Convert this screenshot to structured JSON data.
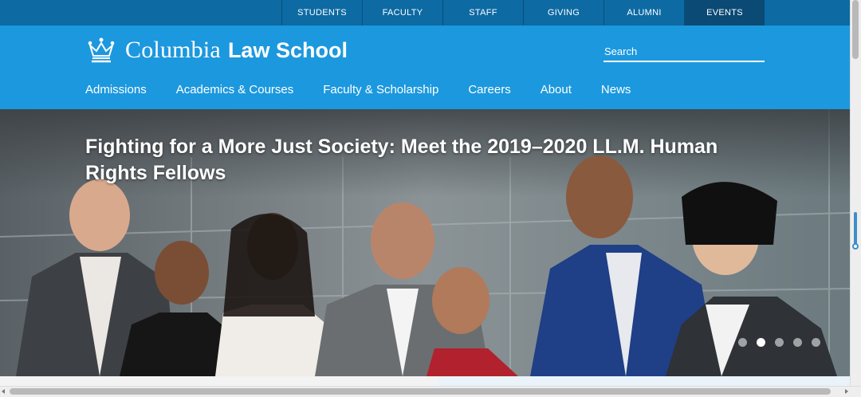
{
  "utility_nav": {
    "items": [
      {
        "label": "STUDENTS"
      },
      {
        "label": "FACULTY"
      },
      {
        "label": "STAFF"
      },
      {
        "label": "GIVING"
      },
      {
        "label": "ALUMNI"
      },
      {
        "label": "EVENTS"
      }
    ],
    "active": "EVENTS"
  },
  "brand": {
    "name_serif": "Columbia",
    "name_sans": "Law School",
    "logo_icon": "crown-icon"
  },
  "search": {
    "placeholder": "Search"
  },
  "main_nav": {
    "items": [
      {
        "label": "Admissions"
      },
      {
        "label": "Academics & Courses"
      },
      {
        "label": "Faculty & Scholarship"
      },
      {
        "label": "Careers"
      },
      {
        "label": "About"
      },
      {
        "label": "News"
      }
    ]
  },
  "hero": {
    "title": "Fighting for a More Just Society: Meet the 2019–2020 LL.M. Human Rights Fellows",
    "slide_count": 5,
    "active_slide": 2
  },
  "colors": {
    "utility_bar": "#0d6aa3",
    "header": "#1c98de",
    "text": "#ffffff"
  }
}
